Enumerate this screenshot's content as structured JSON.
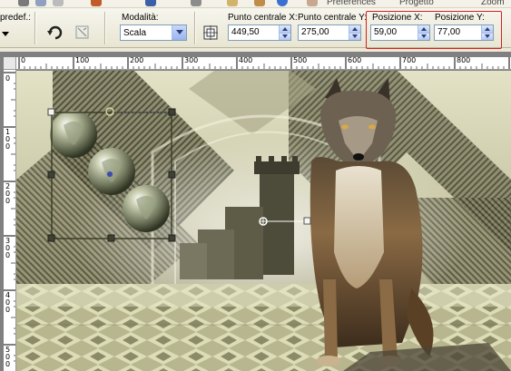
{
  "top_strip": {
    "cut_text_1": "Preferences",
    "cut_text_2": "Progetto",
    "cut_text_3": "Zoom"
  },
  "options_bar": {
    "preset_label": "predef.:",
    "mode_label": "Modalità:",
    "mode_value": "Scala",
    "center_x_label": "Punto centrale X:",
    "center_x_value": "449,50",
    "center_y_label": "Punto centrale Y:",
    "center_y_value": "275,00",
    "pos_x_label": "Posizione X:",
    "pos_x_value": "59,00",
    "pos_y_label": "Posizione Y:",
    "pos_y_value": "77,00"
  },
  "rulers": {
    "top": [
      "0",
      "100",
      "200",
      "300",
      "400",
      "500",
      "600",
      "700",
      "800"
    ],
    "left": [
      "0",
      "100",
      "200",
      "300",
      "400",
      "500"
    ]
  },
  "colors": {
    "accent_highlight": "#d52020",
    "selection_frame": "#3c3f28",
    "canvas_bg": "#c9c7a8"
  }
}
